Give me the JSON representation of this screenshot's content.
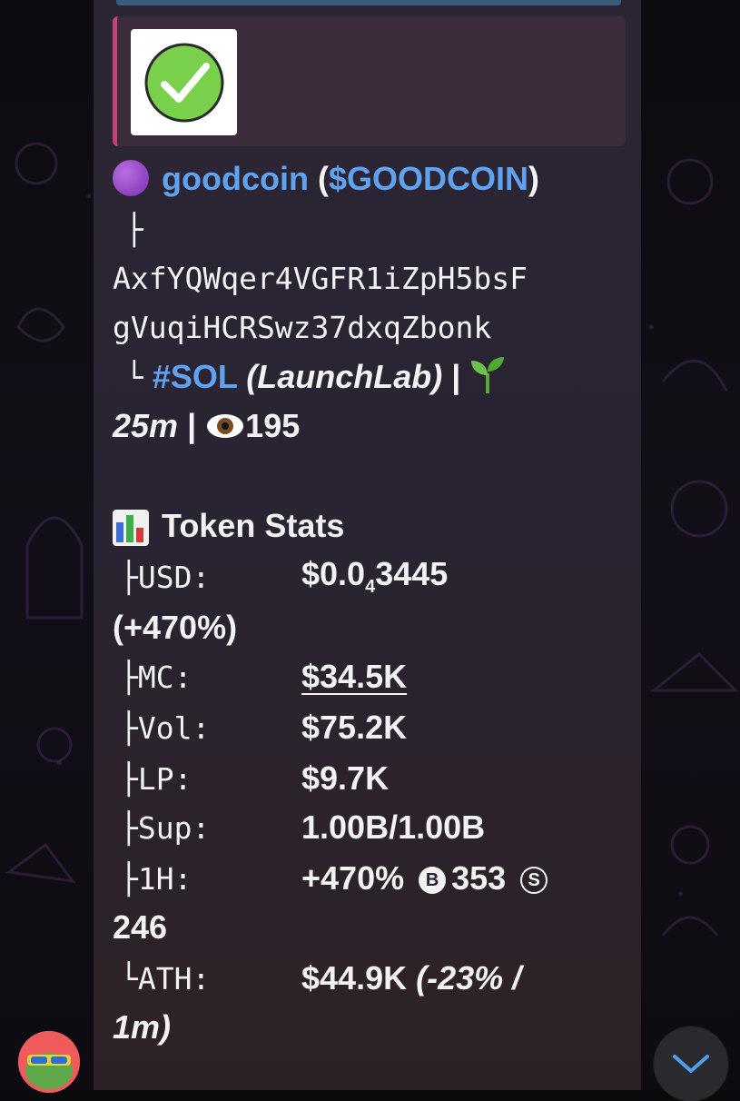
{
  "token": {
    "name": "goodcoin",
    "ticker_open": "(",
    "ticker": "$GOODCOIN",
    "ticker_close": ")",
    "tree_branch": "├",
    "address_line1": "AxfYQWqer4VGFR1iZpH5bsF",
    "address_line2": "gVuqiHCRSwz37dxqZbonk",
    "tree_end": "└",
    "chain": "#SOL",
    "platform": "(LaunchLab)",
    "sep": "|",
    "age": "25m",
    "views": "195"
  },
  "stats": {
    "header": "Token Stats",
    "usd_label": "├USD:",
    "usd_value_prefix": "$0.0",
    "usd_value_sub": "4",
    "usd_value_suffix": "3445",
    "usd_change": "(+470%)",
    "mc_label": "├MC:",
    "mc_value": "$34.5K",
    "vol_label": "├Vol:",
    "vol_value": "$75.2K",
    "lp_label": "├LP:",
    "lp_value": "$9.7K",
    "sup_label": "├Sup:",
    "sup_value": "1.00B/1.00B",
    "h1_label": "├1H:",
    "h1_change": "+470%",
    "buy_glyph": "B",
    "buys": "353",
    "sell_glyph": "S",
    "sells": "246",
    "ath_label": "└ATH:",
    "ath_value": "$44.9K",
    "ath_detail_1": "(-23% /",
    "ath_detail_2": "1m)"
  },
  "icons": {
    "check": "check-mark-icon",
    "coin": "purple-circle-icon",
    "sprout": "seedling-icon",
    "eye": "eye-icon",
    "chart": "bar-chart-icon",
    "scroll": "chevron-down-icon"
  },
  "colors": {
    "link": "#5fa3f0",
    "quote_bar": "#c2427b",
    "bubble": "#2a2331"
  }
}
